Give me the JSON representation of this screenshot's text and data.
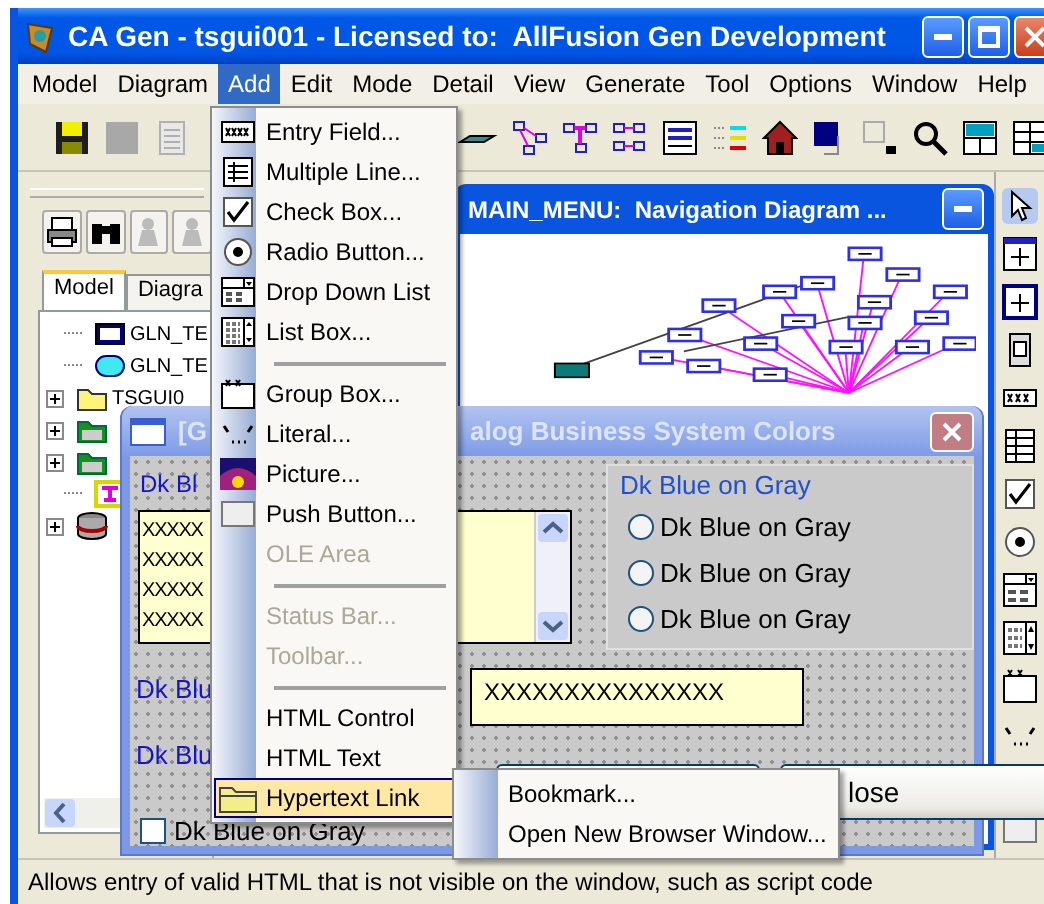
{
  "window": {
    "title": "CA Gen - tsgui001 - Licensed to:  AllFusion Gen Development"
  },
  "menubar": [
    {
      "label": "Model",
      "selected": false
    },
    {
      "label": "Diagram",
      "selected": false
    },
    {
      "label": "Add",
      "selected": true
    },
    {
      "label": "Edit",
      "selected": false
    },
    {
      "label": "Mode",
      "selected": false
    },
    {
      "label": "Detail",
      "selected": false
    },
    {
      "label": "View",
      "selected": false
    },
    {
      "label": "Generate",
      "selected": false
    },
    {
      "label": "Tool",
      "selected": false
    },
    {
      "label": "Options",
      "selected": false
    },
    {
      "label": "Window",
      "selected": false
    },
    {
      "label": "Help",
      "selected": false
    }
  ],
  "left_pane": {
    "tabs": [
      {
        "label": "Model",
        "selected": true
      },
      {
        "label": "Diagra",
        "selected": false
      }
    ],
    "tree": [
      {
        "label": "GLN_TE",
        "expandable": false
      },
      {
        "label": "GLN_TE",
        "expandable": false
      },
      {
        "label": "TSGUI0",
        "expandable": true
      },
      {
        "expandable": true
      },
      {
        "expandable": true
      },
      {
        "expandable": false
      },
      {
        "expandable": true
      }
    ]
  },
  "nav_window": {
    "title": "MAIN_MENU:  Navigation Diagram ..."
  },
  "dialog": {
    "title_parts": [
      "[G",
      "alog Business System Colors"
    ],
    "literal_top": "Dk Bl",
    "group_label": "Dk Blue on Gray",
    "radios": [
      {
        "label": "Dk Blue on Gray",
        "selected": false
      },
      {
        "label": "Dk Blue on Gray",
        "selected": false
      },
      {
        "label": "Dk Blue on Gray",
        "selected": false
      }
    ],
    "list_box": [
      "XXXXX",
      "XXXXX",
      "XXXXX",
      "XXXXX"
    ],
    "literals": [
      "Dk Blu",
      "Dk Blu"
    ],
    "entry_field": {
      "value": "XXXXXXXXXXXXXXX"
    },
    "close_button": "lose",
    "checkbox": {
      "label": "Dk Blue on Gray",
      "checked": false
    }
  },
  "add_menu": {
    "items": [
      {
        "kind": "item",
        "label": "Entry Field...",
        "disabled": false,
        "selected": false,
        "has_submenu": false
      },
      {
        "kind": "item",
        "label": "Multiple Line...",
        "disabled": false,
        "selected": false,
        "has_submenu": false
      },
      {
        "kind": "item",
        "label": "Check Box...",
        "disabled": false,
        "selected": false,
        "has_submenu": false
      },
      {
        "kind": "item",
        "label": "Radio Button...",
        "disabled": false,
        "selected": false,
        "has_submenu": false
      },
      {
        "kind": "item",
        "label": "Drop Down List",
        "disabled": false,
        "selected": false,
        "has_submenu": false
      },
      {
        "kind": "item",
        "label": "List Box...",
        "disabled": false,
        "selected": false,
        "has_submenu": false
      },
      {
        "kind": "separator"
      },
      {
        "kind": "item",
        "label": "Group Box...",
        "disabled": false,
        "selected": false,
        "has_submenu": false
      },
      {
        "kind": "item",
        "label": "Literal...",
        "disabled": false,
        "selected": false,
        "has_submenu": false
      },
      {
        "kind": "item",
        "label": "Picture...",
        "disabled": false,
        "selected": false,
        "has_submenu": false
      },
      {
        "kind": "item",
        "label": "Push Button...",
        "disabled": false,
        "selected": false,
        "has_submenu": false
      },
      {
        "kind": "item",
        "label": "OLE Area",
        "disabled": true,
        "selected": false,
        "has_submenu": false
      },
      {
        "kind": "separator"
      },
      {
        "kind": "item",
        "label": "Status Bar...",
        "disabled": true,
        "selected": false,
        "has_submenu": false
      },
      {
        "kind": "item",
        "label": "Toolbar...",
        "disabled": true,
        "selected": false,
        "has_submenu": false
      },
      {
        "kind": "separator"
      },
      {
        "kind": "item",
        "label": "HTML Control",
        "disabled": false,
        "selected": false,
        "has_submenu": false
      },
      {
        "kind": "item",
        "label": "HTML Text",
        "disabled": false,
        "selected": false,
        "has_submenu": false
      },
      {
        "kind": "item",
        "label": "Hypertext Link",
        "disabled": false,
        "selected": true,
        "has_submenu": true
      }
    ]
  },
  "submenu": {
    "items": [
      {
        "kind": "item",
        "label": "Bookmark...",
        "disabled": false,
        "selected": false,
        "has_submenu": false
      },
      {
        "kind": "item",
        "label": "Open New Browser Window...",
        "disabled": false,
        "selected": false,
        "has_submenu": false
      }
    ]
  },
  "status_bar": {
    "text": "Allows entry of valid HTML that is not visible on the window, such as script code"
  }
}
